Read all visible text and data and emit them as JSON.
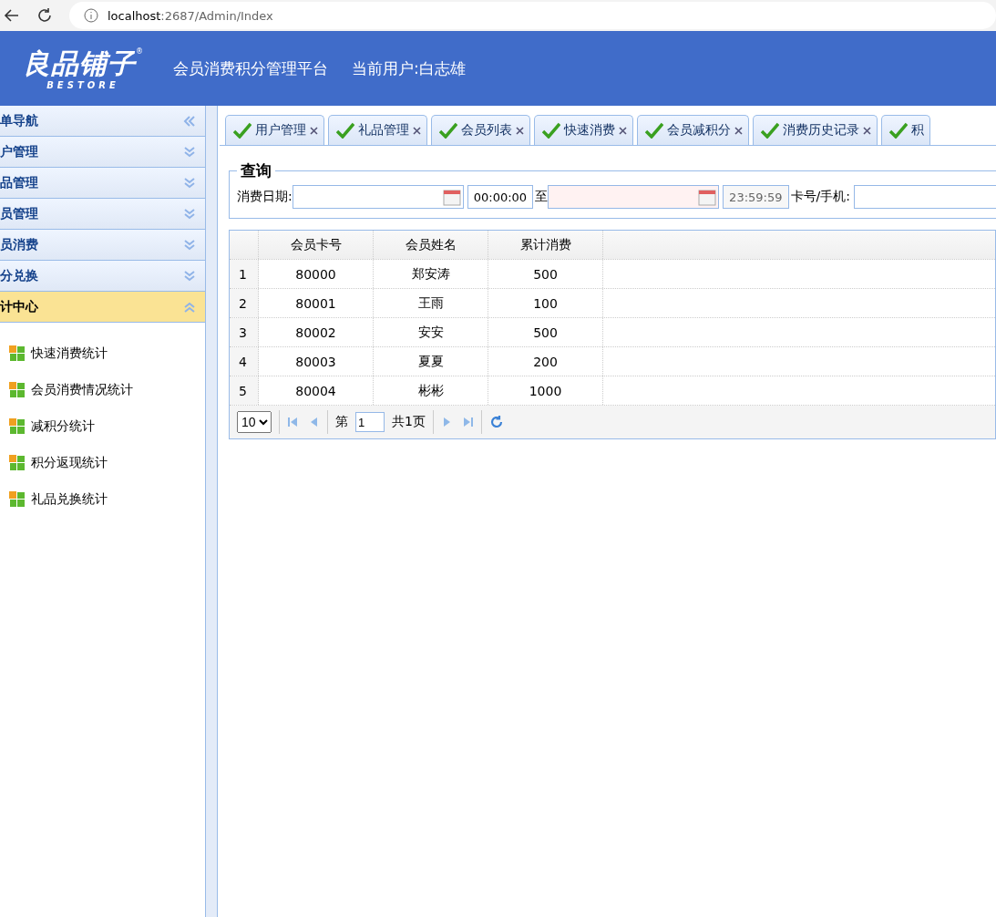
{
  "browser": {
    "url_host": "localhost",
    "url_path": ":2687/Admin/Index"
  },
  "header": {
    "logo": "良品铺子",
    "logo_mark": "®",
    "logo_sub": "BESTORE",
    "title": "会员消费积分管理平台",
    "user": "当前用户:白志雄"
  },
  "sidebar": {
    "title": "单导航",
    "groups": [
      {
        "label": "户管理",
        "expanded": false
      },
      {
        "label": "品管理",
        "expanded": false
      },
      {
        "label": "员管理",
        "expanded": false
      },
      {
        "label": "员消费",
        "expanded": false
      },
      {
        "label": "分兑换",
        "expanded": false
      },
      {
        "label": "计中心",
        "expanded": true
      }
    ],
    "items": [
      "快速消费统计",
      "会员消费情况统计",
      "减积分统计",
      "积分返现统计",
      "礼品兑换统计"
    ]
  },
  "tabs": [
    {
      "label": "用户管理",
      "closable": true
    },
    {
      "label": "礼品管理",
      "closable": true
    },
    {
      "label": "会员列表",
      "closable": true
    },
    {
      "label": "快速消费",
      "closable": true
    },
    {
      "label": "会员减积分",
      "closable": true
    },
    {
      "label": "消费历史记录",
      "closable": true
    },
    {
      "label": "积",
      "closable": false
    }
  ],
  "query": {
    "legend": "查询",
    "date_label": "消费日期:",
    "start_time": "00:00:00",
    "to": "至",
    "end_time": "23:59:59",
    "card_label": "卡号/手机:"
  },
  "table": {
    "columns": [
      "",
      "会员卡号",
      "会员姓名",
      "累计消费"
    ],
    "rows": [
      [
        "1",
        "80000",
        "郑安涛",
        "500"
      ],
      [
        "2",
        "80001",
        "王雨",
        "100"
      ],
      [
        "3",
        "80002",
        "安安",
        "500"
      ],
      [
        "4",
        "80003",
        "夏夏",
        "200"
      ],
      [
        "5",
        "80004",
        "彬彬",
        "1000"
      ]
    ]
  },
  "pager": {
    "page_size": "10",
    "before": "第",
    "page": "1",
    "after": "共1页"
  }
}
